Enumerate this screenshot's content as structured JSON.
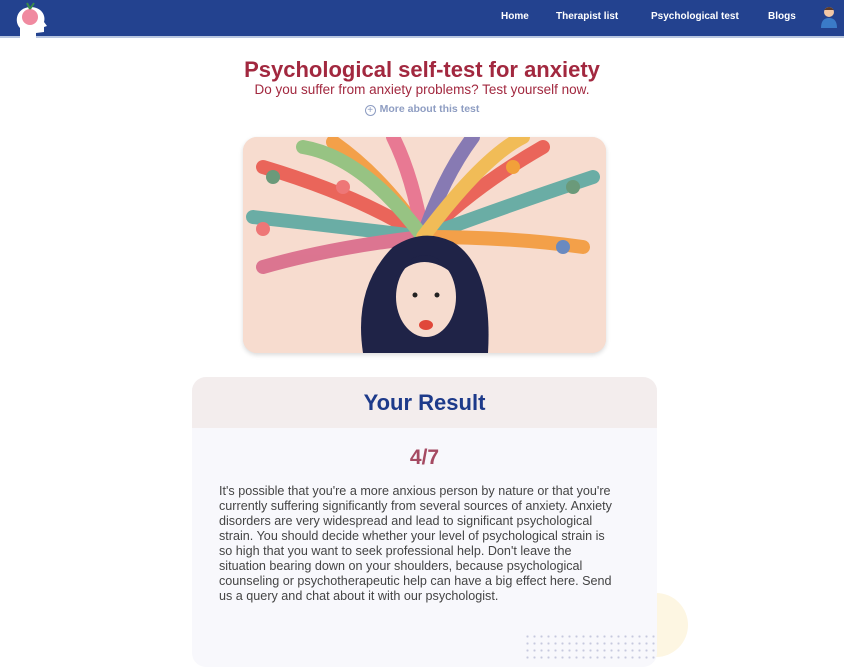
{
  "nav": {
    "items": [
      {
        "label": "Home"
      },
      {
        "label": "Therapist list"
      },
      {
        "label": "Psychological test"
      },
      {
        "label": "Blogs"
      }
    ],
    "logo_icon": "head-brain-icon",
    "avatar_icon": "user-avatar-icon"
  },
  "header": {
    "title": "Psychological self-test for anxiety",
    "subtitle": "Do you suffer from anxiety problems? Test yourself now.",
    "more_label": "More about this test",
    "more_icon": "plus-circle-icon"
  },
  "result": {
    "heading": "Your Result",
    "score": "4/7",
    "text": "It's possible that you're a more anxious person by nature or that you're currently suffering significantly from several sources of anxiety. Anxiety disorders are very widespread and lead to significant psychological strain. You should decide whether your level of psychological strain is so high that you want to seek professional help. Don't leave the situation bearing down on your shoulders, because psychological counseling or psychotherapeutic help can have a big effect here. Send us a query and chat about it with our psychologist."
  },
  "colors": {
    "nav": "#23428f",
    "title": "#a2283f",
    "heading": "#1d3a8a",
    "score": "#a54a62"
  }
}
